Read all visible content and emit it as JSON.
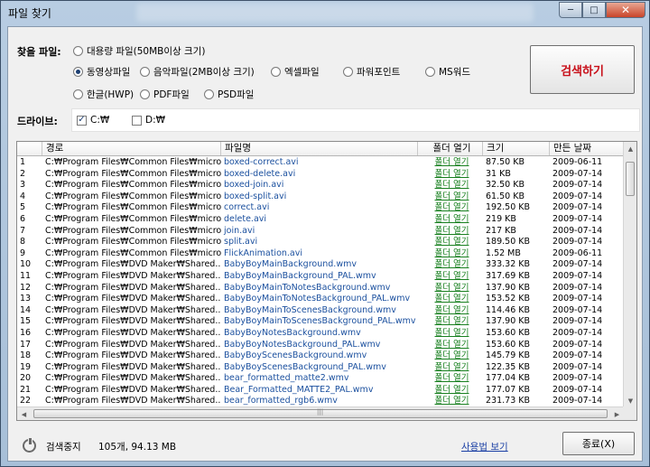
{
  "window": {
    "title": "파일 찾기"
  },
  "search": {
    "label": "찾을 파일:",
    "options": [
      {
        "label": "대용량 파일(50MB이상 크기)",
        "checked": false
      },
      {
        "label": "동영상파일",
        "checked": true
      },
      {
        "label": "음악파일(2MB이상 크기)",
        "checked": false
      },
      {
        "label": "엑셀파일",
        "checked": false
      },
      {
        "label": "파워포인트",
        "checked": false
      },
      {
        "label": "MS워드",
        "checked": false
      },
      {
        "label": "한글(HWP)",
        "checked": false
      },
      {
        "label": "PDF파일",
        "checked": false
      },
      {
        "label": "PSD파일",
        "checked": false
      }
    ],
    "button": "검색하기"
  },
  "drives": {
    "label": "드라이브:",
    "items": [
      {
        "label": "C:₩",
        "checked": true,
        "mark": "✓"
      },
      {
        "label": "D:₩",
        "checked": false,
        "mark": ""
      }
    ]
  },
  "table": {
    "columns": [
      "",
      "경로",
      "파일명",
      "폴더 열기",
      "크기",
      "만든 날짜"
    ],
    "open_label": "폴더 열기",
    "rows": [
      [
        "1",
        "C:₩Program Files₩Common Files₩micro...",
        "boxed-correct.avi",
        "87.50 KB",
        "2009-06-11"
      ],
      [
        "2",
        "C:₩Program Files₩Common Files₩micro...",
        "boxed-delete.avi",
        "31 KB",
        "2009-07-14"
      ],
      [
        "3",
        "C:₩Program Files₩Common Files₩micro...",
        "boxed-join.avi",
        "32.50 KB",
        "2009-07-14"
      ],
      [
        "4",
        "C:₩Program Files₩Common Files₩micro...",
        "boxed-split.avi",
        "61.50 KB",
        "2009-07-14"
      ],
      [
        "5",
        "C:₩Program Files₩Common Files₩micro...",
        "correct.avi",
        "192.50 KB",
        "2009-07-14"
      ],
      [
        "6",
        "C:₩Program Files₩Common Files₩micro...",
        "delete.avi",
        "219 KB",
        "2009-07-14"
      ],
      [
        "7",
        "C:₩Program Files₩Common Files₩micro...",
        "join.avi",
        "217 KB",
        "2009-07-14"
      ],
      [
        "8",
        "C:₩Program Files₩Common Files₩micro...",
        "split.avi",
        "189.50 KB",
        "2009-07-14"
      ],
      [
        "9",
        "C:₩Program Files₩Common Files₩micro...",
        "FlickAnimation.avi",
        "1.52 MB",
        "2009-06-11"
      ],
      [
        "10",
        "C:₩Program Files₩DVD Maker₩Shared...",
        "BabyBoyMainBackground.wmv",
        "333.32 KB",
        "2009-07-14"
      ],
      [
        "11",
        "C:₩Program Files₩DVD Maker₩Shared...",
        "BabyBoyMainBackground_PAL.wmv",
        "317.69 KB",
        "2009-07-14"
      ],
      [
        "12",
        "C:₩Program Files₩DVD Maker₩Shared...",
        "BabyBoyMainToNotesBackground.wmv",
        "137.90 KB",
        "2009-07-14"
      ],
      [
        "13",
        "C:₩Program Files₩DVD Maker₩Shared...",
        "BabyBoyMainToNotesBackground_PAL.wmv",
        "153.52 KB",
        "2009-07-14"
      ],
      [
        "14",
        "C:₩Program Files₩DVD Maker₩Shared...",
        "BabyBoyMainToScenesBackground.wmv",
        "114.46 KB",
        "2009-07-14"
      ],
      [
        "15",
        "C:₩Program Files₩DVD Maker₩Shared...",
        "BabyBoyMainToScenesBackground_PAL.wmv",
        "137.90 KB",
        "2009-07-14"
      ],
      [
        "16",
        "C:₩Program Files₩DVD Maker₩Shared...",
        "BabyBoyNotesBackground.wmv",
        "153.60 KB",
        "2009-07-14"
      ],
      [
        "17",
        "C:₩Program Files₩DVD Maker₩Shared...",
        "BabyBoyNotesBackground_PAL.wmv",
        "153.60 KB",
        "2009-07-14"
      ],
      [
        "18",
        "C:₩Program Files₩DVD Maker₩Shared...",
        "BabyBoyScenesBackground.wmv",
        "145.79 KB",
        "2009-07-14"
      ],
      [
        "19",
        "C:₩Program Files₩DVD Maker₩Shared...",
        "BabyBoyScenesBackground_PAL.wmv",
        "122.35 KB",
        "2009-07-14"
      ],
      [
        "20",
        "C:₩Program Files₩DVD Maker₩Shared...",
        "bear_formatted_matte2.wmv",
        "177.04 KB",
        "2009-07-14"
      ],
      [
        "21",
        "C:₩Program Files₩DVD Maker₩Shared...",
        "Bear_Formatted_MATTE2_PAL.wmv",
        "177.07 KB",
        "2009-07-14"
      ],
      [
        "22",
        "C:₩Program Files₩DVD Maker₩Shared...",
        "bear_formatted_rgb6.wmv",
        "231.73 KB",
        "2009-07-14"
      ]
    ]
  },
  "status": {
    "text": "검색중지",
    "count": "105개, 94.13 MB",
    "help": "사용법 보기",
    "close": "종료(X)"
  },
  "controls": {
    "min": "─",
    "max": "□",
    "close": "✕"
  },
  "scroll": {
    "up": "▲",
    "down": "▼",
    "left": "◀",
    "right": "▶",
    "grip": "|||"
  },
  "colors": {
    "accent_red": "#c8101a",
    "file_blue": "#1a4f9e",
    "link_green": "#18801f"
  }
}
